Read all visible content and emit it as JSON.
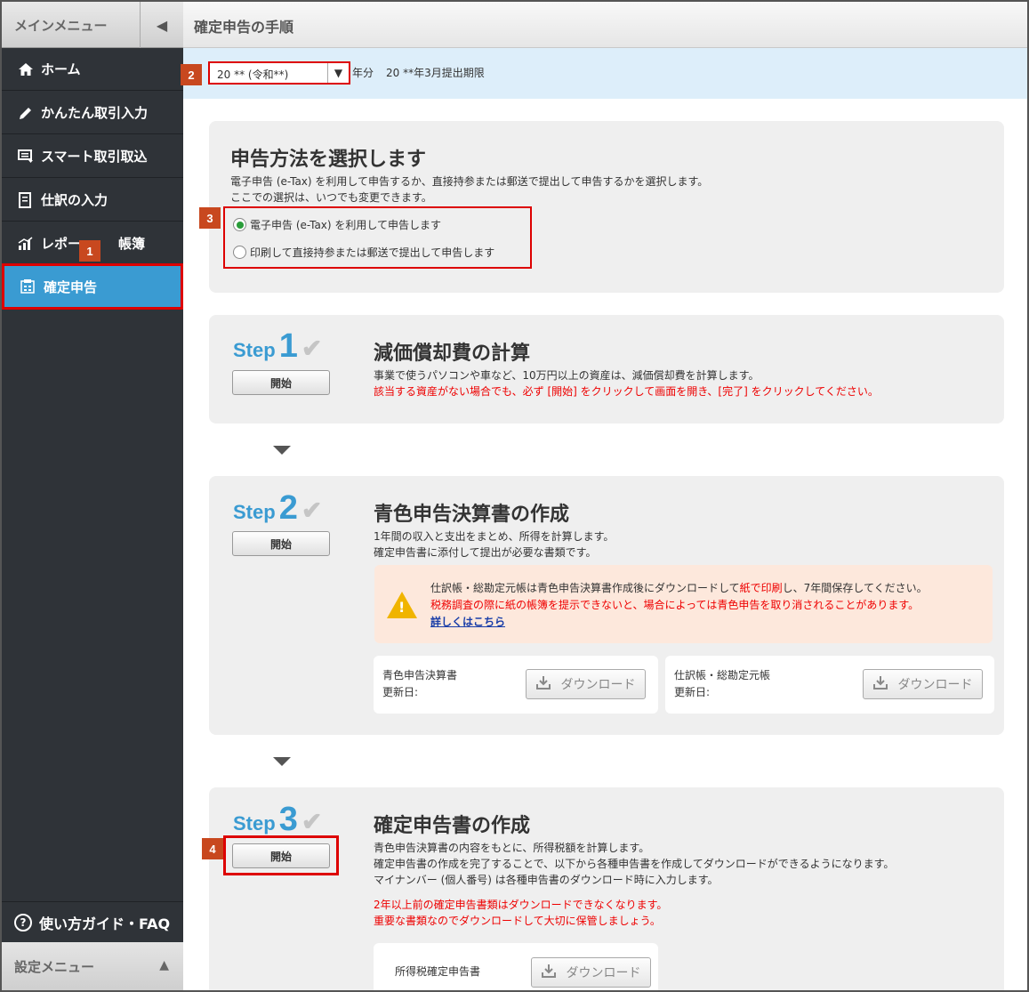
{
  "sidebar": {
    "header": "メインメニュー",
    "toggle_icon": "◀",
    "items": [
      {
        "label": "ホーム",
        "icon": "home-icon"
      },
      {
        "label": "かんたん取引入力",
        "icon": "pencil-icon"
      },
      {
        "label": "スマート取引取込",
        "icon": "import-icon"
      },
      {
        "label": "仕訳の入力",
        "icon": "journal-icon"
      },
      {
        "label": "レポー",
        "label_rest": "帳簿",
        "icon": "chart-icon"
      },
      {
        "label": "確定申告",
        "icon": "tax-return-icon"
      }
    ],
    "guide": "使い方ガイド・FAQ",
    "settings": "設定メニュー"
  },
  "header": {
    "title": "確定申告の手順"
  },
  "year": {
    "selected": "20 ** (令和**)",
    "suffix": "年分",
    "deadline": "20 **年3月提出期限"
  },
  "badges": [
    "1",
    "2",
    "3",
    "4"
  ],
  "method": {
    "heading": "申告方法を選択します",
    "desc1": "電子申告 (e-Tax) を利用して申告するか、直接持参または郵送で提出して申告するかを選択します。",
    "desc2": "ここでの選択は、いつでも変更できます。",
    "option1": "電子申告 (e-Tax) を利用して申告します",
    "option2": "印刷して直接持参または郵送で提出して申告します"
  },
  "step_word": "Step",
  "start_label": "開始",
  "step1": {
    "num": "1",
    "heading": "減価償却費の計算",
    "desc": "事業で使うパソコンや車など、10万円以上の資産は、減価償却費を計算します。",
    "note": "該当する資産がない場合でも、必ず [開始] をクリックして画面を開き、[完了] をクリックしてください。"
  },
  "step2": {
    "num": "2",
    "heading": "青色申告決算書の作成",
    "desc1": "1年間の収入と支出をまとめ、所得を計算します。",
    "desc2": "確定申告書に添付して提出が必要な書類です。",
    "warn1a": "仕訳帳・総勘定元帳は青色申告決算書作成後にダウンロードして",
    "warn1b": "紙で印刷",
    "warn1c": "し、7年間保存してください。",
    "warn2": "税務調査の際に紙の帳簿を提示できないと、場合によっては青色申告を取り消されることがあります。",
    "warn_link": "詳しくはこちら",
    "card1_title": "青色申告決算書",
    "card1_updated": "更新日:",
    "card2_title": "仕訳帳・総勘定元帳",
    "card2_updated": "更新日:",
    "download": "ダウンロード"
  },
  "step3": {
    "num": "3",
    "heading": "確定申告書の作成",
    "desc1": "青色申告決算書の内容をもとに、所得税額を計算します。",
    "desc2": "確定申告書の作成を完了することで、以下から各種申告書を作成してダウンロードができるようになります。",
    "desc3": "マイナンバー (個人番号) は各種申告書のダウンロード時に入力します。",
    "note1": "2年以上前の確定申告書類はダウンロードできなくなります。",
    "note2": "重要な書類なのでダウンロードして大切に保管しましょう。",
    "card_title": "所得税確定申告書",
    "download": "ダウンロード"
  }
}
